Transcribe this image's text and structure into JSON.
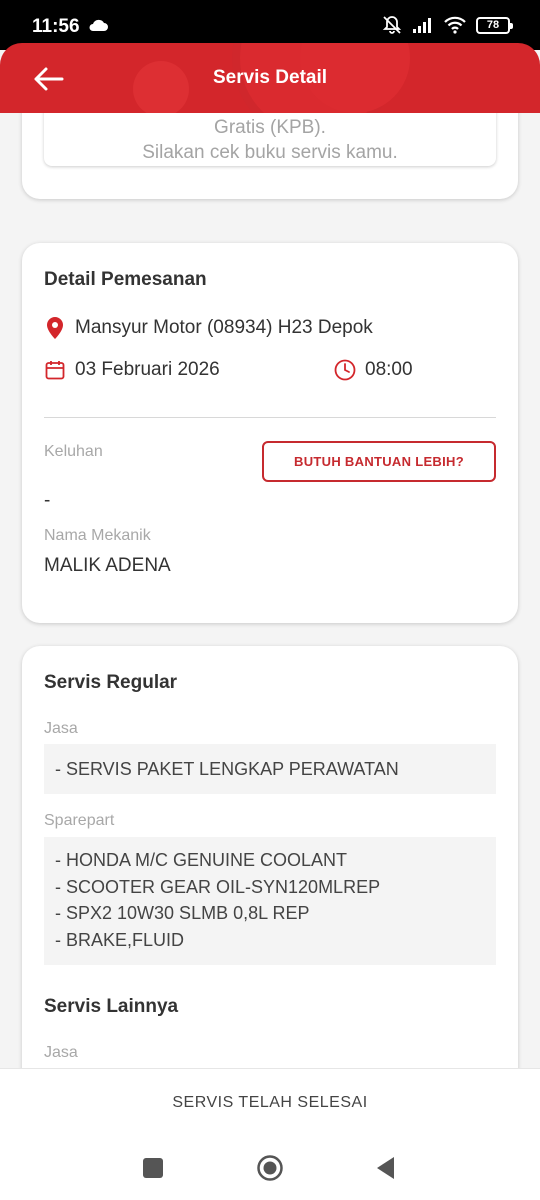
{
  "status_bar": {
    "time": "11:56",
    "battery": "78"
  },
  "app_bar": {
    "title": "Servis Detail"
  },
  "top_card": {
    "line1": "Gratis (KPB).",
    "line2": "Silakan cek buku servis kamu."
  },
  "detail": {
    "title": "Detail Pemesanan",
    "dealer": "Mansyur Motor (08934) H23 Depok",
    "date": "03 Februari 2026",
    "time": "08:00",
    "keluhan_label": "Keluhan",
    "keluhan_value": "-",
    "help_button": "BUTUH BANTUAN LEBIH?",
    "mekanik_label": "Nama Mekanik",
    "mekanik_value": "MALIK ADENA"
  },
  "service": {
    "regular_title": "Servis Regular",
    "jasa_label": "Jasa",
    "jasa_items": [
      "- SERVIS PAKET LENGKAP PERAWATAN"
    ],
    "sparepart_label": "Sparepart",
    "sparepart_items": [
      "- HONDA M/C GENUINE COOLANT",
      "- SCOOTER GEAR OIL-SYN120MLREP",
      "- SPX2 10W30 SLMB 0,8L REP",
      "- BRAKE,FLUID"
    ],
    "other_title": "Servis Lainnya",
    "other_jasa_label": "Jasa"
  },
  "bottom_action": {
    "label": "SERVIS TELAH SELESAI"
  },
  "colors": {
    "primary": "#d3262b",
    "accent_border": "#c62a2f"
  }
}
